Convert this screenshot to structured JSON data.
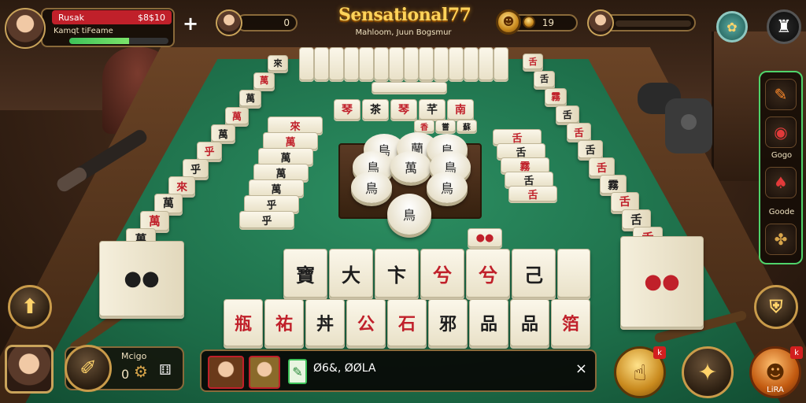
{
  "game": {
    "title": "Sensational77",
    "subtitle": "Mahloom, Juun Bogsmur"
  },
  "player_top_left": {
    "name": "Rusak",
    "score": "$8$10",
    "info": "Kamqt tiFeame",
    "health_fraction": 0.6
  },
  "player_top_center": {
    "plus": "+",
    "score": "0"
  },
  "player_top_right": {
    "value": "19"
  },
  "bottom_left": {
    "label": "Mcigo",
    "count": "0"
  },
  "chat_bar": {
    "text": "Ø6&, ØØLA",
    "close": "×"
  },
  "side_panel": {
    "label_1": "Gogo",
    "label_2": "Goode"
  },
  "buttons": {
    "bottom_right_label": "LiRA",
    "badge": "k"
  },
  "glyphs": {
    "hand": [
      "瓶",
      "祐",
      "丼",
      "公",
      "石",
      "邪",
      "品",
      "品",
      "箔"
    ],
    "hand_red": [
      true,
      true,
      false,
      true,
      true,
      false,
      false,
      false,
      true
    ],
    "front": [
      "寶",
      "大",
      "卞",
      "兮",
      "兮",
      "己"
    ],
    "front_red": [
      false,
      false,
      false,
      true,
      true,
      false
    ],
    "center_row1": [
      "琴",
      "茶",
      "琴",
      "芊",
      "南"
    ],
    "center_row2": [
      "香",
      "嘗",
      "蘇"
    ],
    "left_stack": [
      "來",
      "萬",
      "萬",
      "萬",
      "萬",
      "乎",
      "乎"
    ],
    "right_stack": [
      "舌",
      "舌",
      "霧",
      "舌",
      "舌"
    ],
    "discs": [
      "鳥",
      "蘭",
      "鳥",
      "鳥",
      "萬",
      "鳥",
      "鳥",
      "鳥"
    ]
  },
  "colors": {
    "felt": "#1c6b47",
    "gold": "#ffd35a",
    "panel_border": "#8a6a3a",
    "side_panel_border": "#4fd36a",
    "health": "#3ec25a"
  },
  "icons": {
    "side_panel": [
      "carrot-icon",
      "clock-icon",
      "crab-icon",
      "paw-icon"
    ],
    "hud": [
      "arrow-up-icon",
      "brush-icon",
      "gear-icon",
      "coin-icon",
      "shield-icon",
      "hand-icon",
      "tortoise-icon",
      "flag-icon"
    ]
  }
}
